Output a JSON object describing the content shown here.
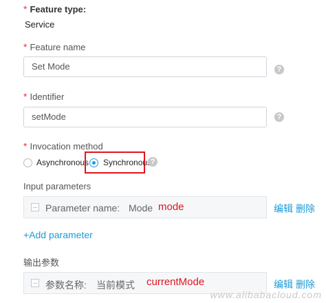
{
  "feature_type": {
    "label": "Feature type:",
    "value": "Service"
  },
  "feature_name": {
    "label": "Feature name",
    "value": "Set Mode"
  },
  "identifier": {
    "label": "Identifier",
    "value": "setMode"
  },
  "invocation": {
    "label": "Invocation method",
    "options": [
      "Asynchronous",
      "Synchronous"
    ],
    "selected": "Synchronous"
  },
  "input_params": {
    "label": "Input parameters",
    "row": {
      "prefix": "Parameter name:",
      "name": "Mode",
      "id": "mode",
      "edit": "编辑",
      "delete": "删除"
    },
    "add_label": "+Add parameter"
  },
  "output_params": {
    "label": "输出参数",
    "row": {
      "prefix": "参数名称:",
      "name": "当前模式",
      "id": "currentMode",
      "edit": "编辑",
      "delete": "删除"
    }
  },
  "help_glyph": "?",
  "watermark": "www.alibabacloud.com",
  "colors": {
    "required": "#e4393c",
    "accent": "#1e9bd7",
    "highlight_box": "#e0141e"
  }
}
